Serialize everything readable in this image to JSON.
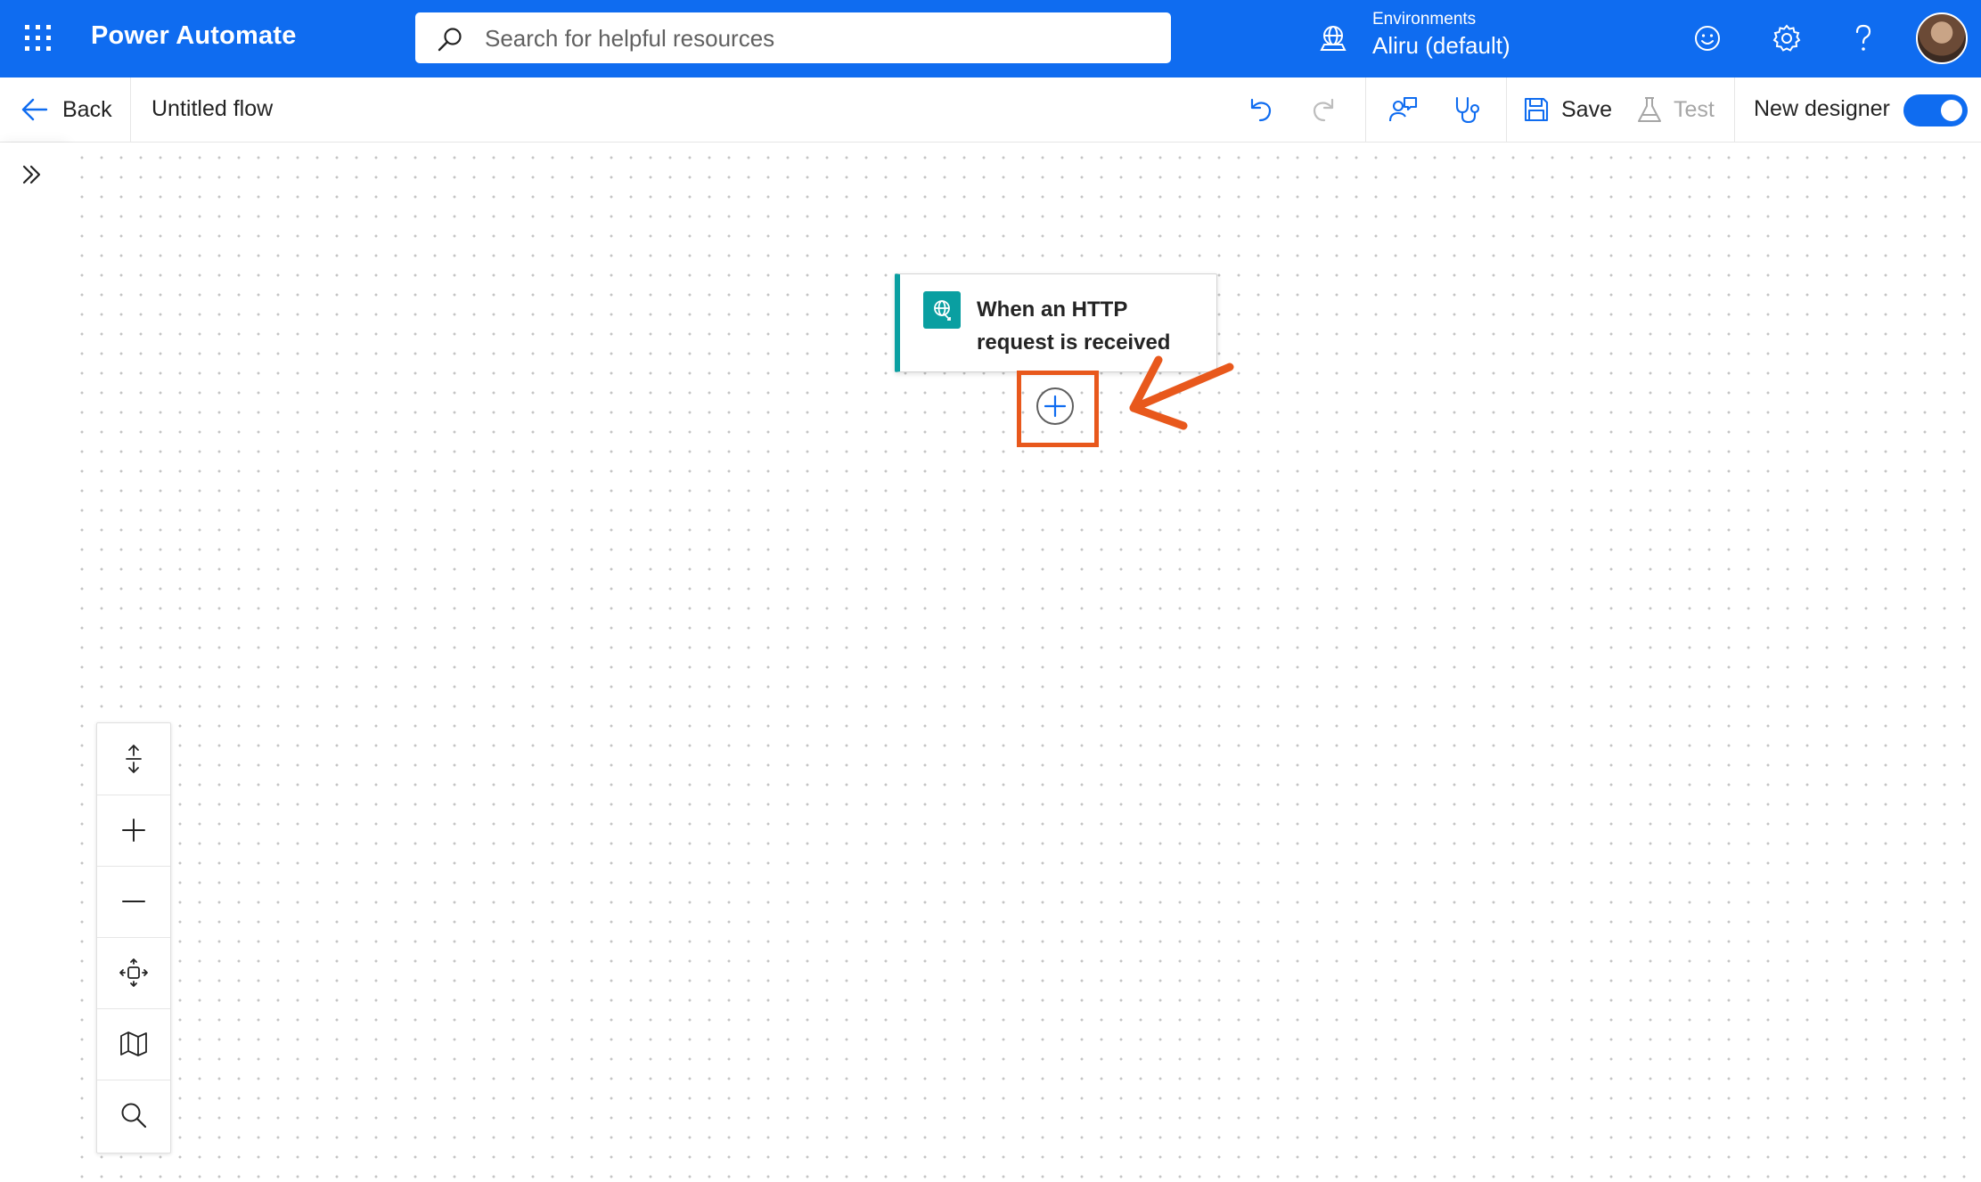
{
  "app": {
    "title": "Power Automate"
  },
  "search": {
    "placeholder": "Search for helpful resources"
  },
  "environment": {
    "label": "Environments",
    "value": "Aliru (default)"
  },
  "commandbar": {
    "back_label": "Back",
    "flow_name": "Untitled flow",
    "save_label": "Save",
    "test_label": "Test",
    "new_designer_label": "New designer",
    "new_designer_on": true
  },
  "canvas": {
    "trigger": {
      "title": "When an HTTP request is received",
      "icon": "http-request-icon"
    },
    "add_step_icon": "add-step-icon"
  },
  "controls": [
    "fit-vertical-icon",
    "zoom-in-icon",
    "zoom-out-icon",
    "fit-view-icon",
    "minimap-icon",
    "search-icon"
  ],
  "colors": {
    "header_bg": "#0f6cf0",
    "accent": "#0f6cf0",
    "trigger_teal": "#0a9fa1",
    "highlight": "#e8581c"
  }
}
